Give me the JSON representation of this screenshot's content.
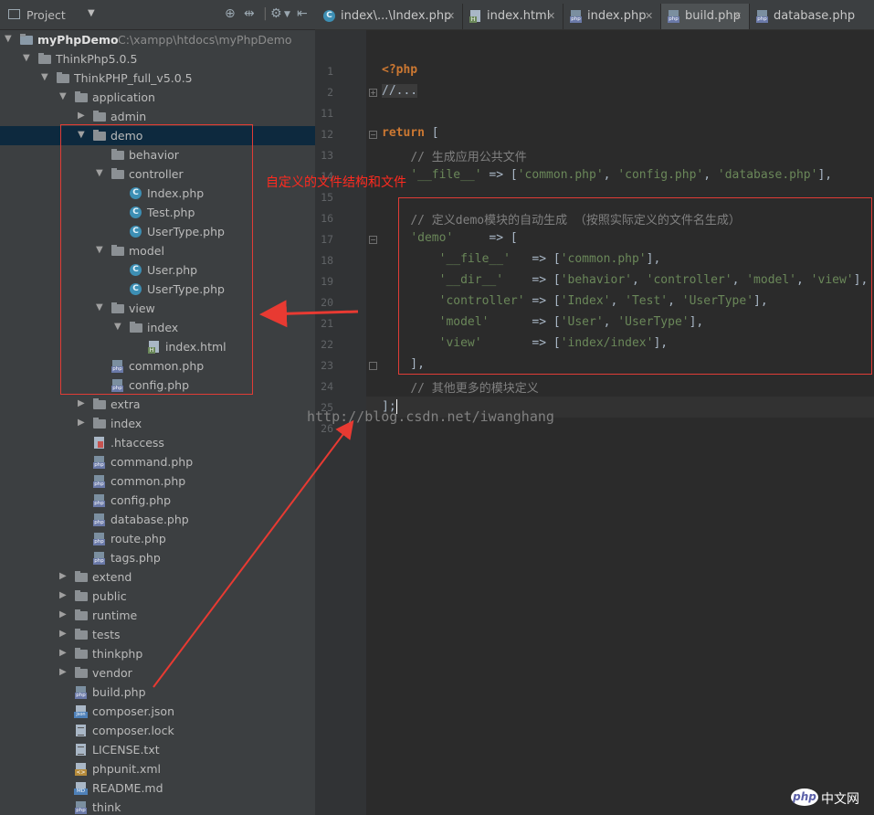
{
  "project_panel": {
    "title": "Project",
    "tree": [
      {
        "label": "myPhpDemo",
        "path": "C:\\xampp\\htdocs\\myPhpDemo",
        "type": "module",
        "depth": 0,
        "expanded": true,
        "bold": true
      },
      {
        "label": "ThinkPhp5.0.5",
        "type": "folder",
        "depth": 1,
        "expanded": true
      },
      {
        "label": "ThinkPHP_full_v5.0.5",
        "type": "folder",
        "depth": 2,
        "expanded": true
      },
      {
        "label": "application",
        "type": "folder",
        "depth": 3,
        "expanded": true
      },
      {
        "label": "admin",
        "type": "folder",
        "depth": 4,
        "expanded": false
      },
      {
        "label": "demo",
        "type": "folder",
        "depth": 4,
        "expanded": true,
        "selected": true
      },
      {
        "label": "behavior",
        "type": "folder",
        "depth": 5,
        "leaf": true
      },
      {
        "label": "controller",
        "type": "folder",
        "depth": 5,
        "expanded": true
      },
      {
        "label": "Index.php",
        "type": "phpclass",
        "depth": 6
      },
      {
        "label": "Test.php",
        "type": "phpclass",
        "depth": 6
      },
      {
        "label": "UserType.php",
        "type": "phpclass",
        "depth": 6
      },
      {
        "label": "model",
        "type": "folder",
        "depth": 5,
        "expanded": true
      },
      {
        "label": "User.php",
        "type": "phpclass",
        "depth": 6
      },
      {
        "label": "UserType.php",
        "type": "phpclass",
        "depth": 6
      },
      {
        "label": "view",
        "type": "folder",
        "depth": 5,
        "expanded": true
      },
      {
        "label": "index",
        "type": "folder",
        "depth": 6,
        "expanded": true
      },
      {
        "label": "index.html",
        "type": "htmlfile",
        "depth": 7
      },
      {
        "label": "common.php",
        "type": "phpfile",
        "depth": 5
      },
      {
        "label": "config.php",
        "type": "phpfile",
        "depth": 5
      },
      {
        "label": "extra",
        "type": "folder",
        "depth": 4,
        "expanded": false
      },
      {
        "label": "index",
        "type": "folder",
        "depth": 4,
        "expanded": false
      },
      {
        "label": ".htaccess",
        "type": "htaccess",
        "depth": 4
      },
      {
        "label": "command.php",
        "type": "phpfile",
        "depth": 4
      },
      {
        "label": "common.php",
        "type": "phpfile",
        "depth": 4
      },
      {
        "label": "config.php",
        "type": "phpfile",
        "depth": 4
      },
      {
        "label": "database.php",
        "type": "phpfile",
        "depth": 4
      },
      {
        "label": "route.php",
        "type": "phpfile",
        "depth": 4
      },
      {
        "label": "tags.php",
        "type": "phpfile",
        "depth": 4
      },
      {
        "label": "extend",
        "type": "folder",
        "depth": 3,
        "expanded": false
      },
      {
        "label": "public",
        "type": "folder",
        "depth": 3,
        "expanded": false
      },
      {
        "label": "runtime",
        "type": "folder",
        "depth": 3,
        "expanded": false
      },
      {
        "label": "tests",
        "type": "folder",
        "depth": 3,
        "expanded": false
      },
      {
        "label": "thinkphp",
        "type": "folder",
        "depth": 3,
        "expanded": false
      },
      {
        "label": "vendor",
        "type": "folder",
        "depth": 3,
        "expanded": false
      },
      {
        "label": "build.php",
        "type": "phpfile",
        "depth": 3
      },
      {
        "label": "composer.json",
        "type": "jsonfile",
        "depth": 3
      },
      {
        "label": "composer.lock",
        "type": "textfile",
        "depth": 3
      },
      {
        "label": "LICENSE.txt",
        "type": "textfile",
        "depth": 3
      },
      {
        "label": "phpunit.xml",
        "type": "xmlfile",
        "depth": 3
      },
      {
        "label": "README.md",
        "type": "mdfile",
        "depth": 3
      },
      {
        "label": "think",
        "type": "phpfile",
        "depth": 3
      }
    ]
  },
  "tabs": [
    {
      "label": "index\\...\\Index.php",
      "icon": "php-class-icon",
      "active": false
    },
    {
      "label": "index.html",
      "icon": "html-file-icon",
      "active": false
    },
    {
      "label": "index.php",
      "icon": "php-file-icon",
      "active": false
    },
    {
      "label": "build.php",
      "icon": "php-file-icon",
      "active": true
    },
    {
      "label": "database.php",
      "icon": "php-file-icon",
      "active": false
    }
  ],
  "editor": {
    "lines": [
      {
        "num": "1",
        "html": "<span class=\"tag\">&lt;?php</span>"
      },
      {
        "num": "2",
        "html": "<span class=\"fold-block cmt\">//...</span>",
        "fold": "plus"
      },
      {
        "num": "11",
        "html": ""
      },
      {
        "num": "12",
        "html": "<span class=\"kw\">return</span> [",
        "fold": "minus"
      },
      {
        "num": "13",
        "html": "    <span class=\"cmt\">// 生成应用公共文件</span>"
      },
      {
        "num": "14",
        "html": "    <span class=\"str\">'__file__'</span> =&gt; [<span class=\"str\">'common.php'</span>, <span class=\"str\">'config.php'</span>, <span class=\"str\">'database.php'</span>],"
      },
      {
        "num": "15",
        "html": ""
      },
      {
        "num": "16",
        "html": "    <span class=\"cmt\">// 定义demo模块的自动生成 （按照实际定义的文件名生成）</span>"
      },
      {
        "num": "17",
        "html": "    <span class=\"str\">'demo'</span>     =&gt; [",
        "fold": "minus"
      },
      {
        "num": "18",
        "html": "        <span class=\"str\">'__file__'</span>   =&gt; [<span class=\"str\">'common.php'</span>],"
      },
      {
        "num": "19",
        "html": "        <span class=\"str\">'__dir__'</span>    =&gt; [<span class=\"str\">'behavior'</span>, <span class=\"str\">'controller'</span>, <span class=\"str\">'model'</span>, <span class=\"str\">'view'</span>],"
      },
      {
        "num": "20",
        "html": "        <span class=\"str\">'controller'</span> =&gt; [<span class=\"str\">'Index'</span>, <span class=\"str\">'Test'</span>, <span class=\"str\">'UserType'</span>],"
      },
      {
        "num": "21",
        "html": "        <span class=\"str\">'model'</span>      =&gt; [<span class=\"str\">'User'</span>, <span class=\"str\">'UserType'</span>],"
      },
      {
        "num": "22",
        "html": "        <span class=\"str\">'view'</span>       =&gt; [<span class=\"str\">'index/index'</span>],"
      },
      {
        "num": "23",
        "html": "    ],",
        "fold": "end"
      },
      {
        "num": "24",
        "html": "    <span class=\"cmt\">// 其他更多的模块定义</span>"
      },
      {
        "num": "25",
        "html": "];<span class=\"caret\"></span>",
        "fold": "end"
      },
      {
        "num": "26",
        "html": ""
      }
    ]
  },
  "annotation": {
    "text": "自定义的文件结构和文件",
    "color": "#ff2a1f"
  },
  "watermark": "http://blog.csdn.net/iwanghang",
  "site_logo": {
    "badge": "php",
    "text": "中文网"
  }
}
